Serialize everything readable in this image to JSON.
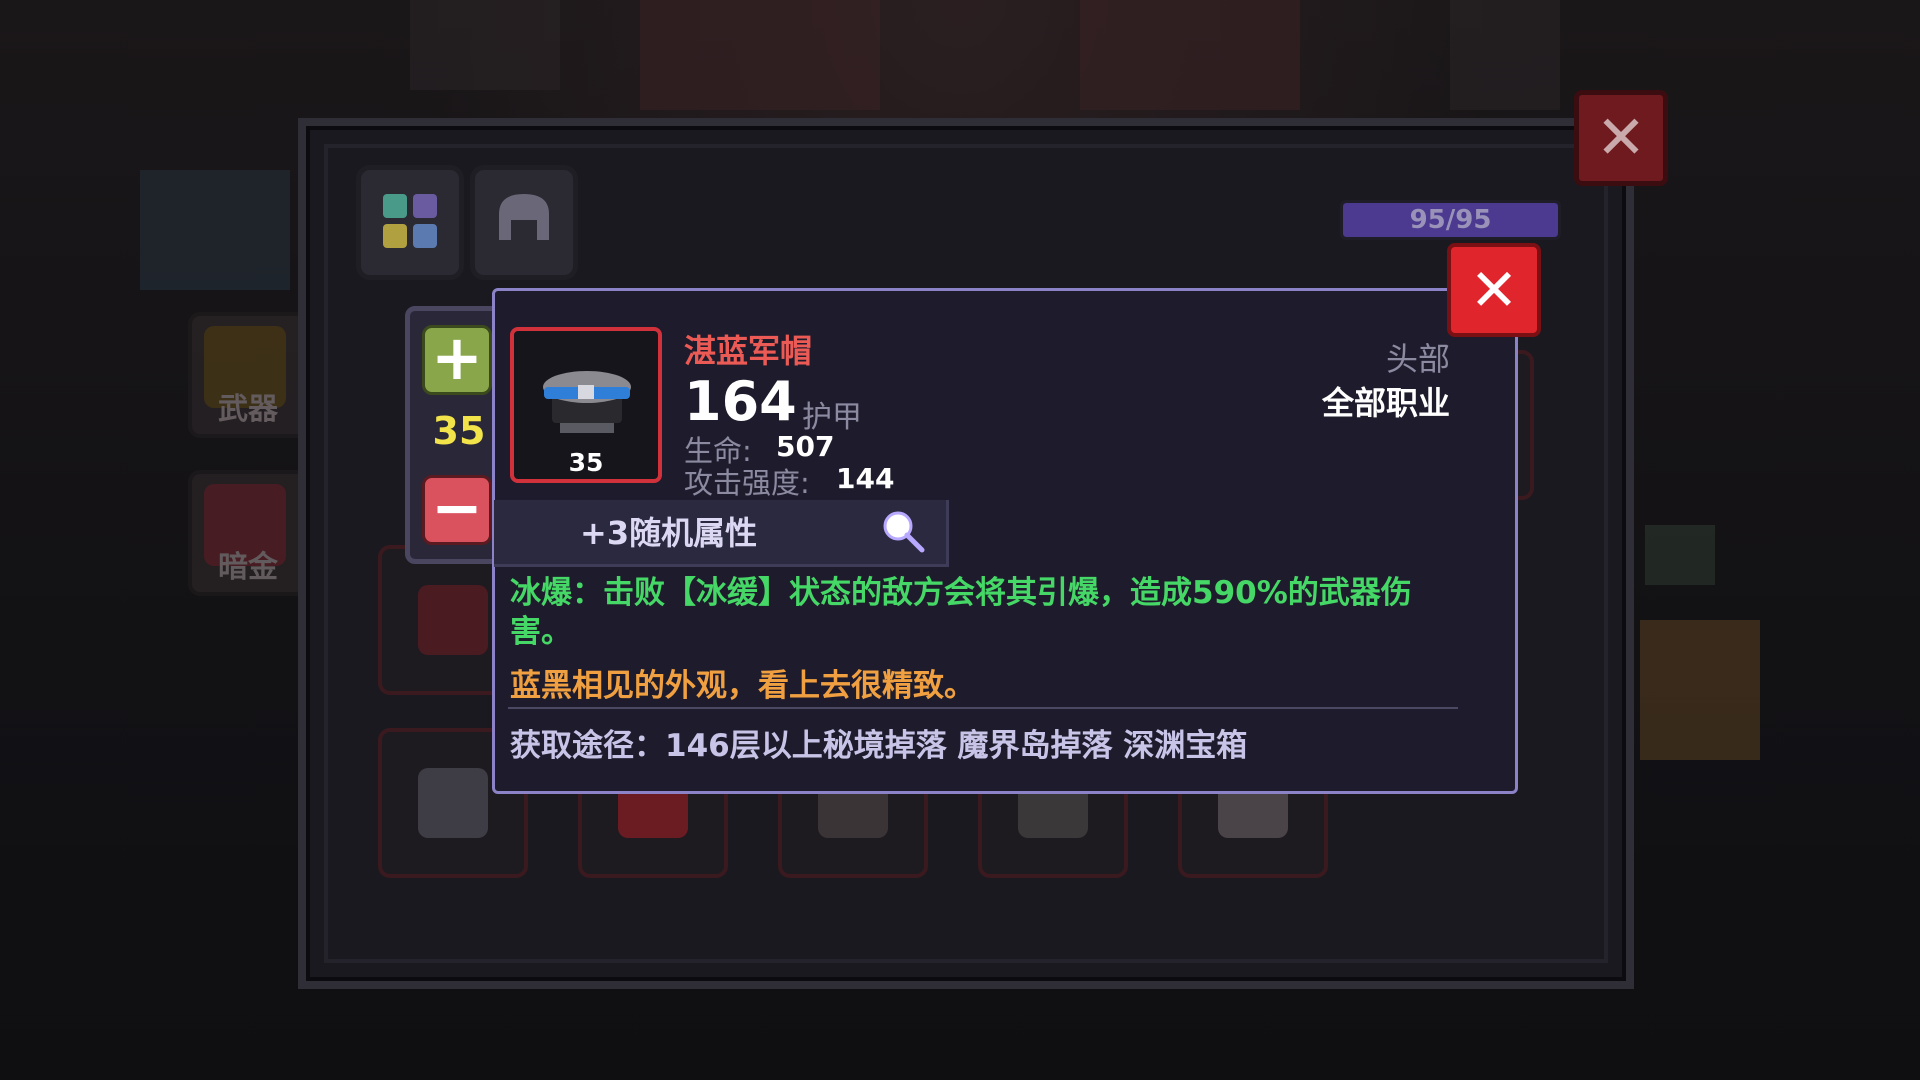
{
  "side_menu": [
    {
      "label": "武器"
    },
    {
      "label": "暗金"
    }
  ],
  "inventory": {
    "capacity_text": "95/95",
    "capacity_fraction": 1.0
  },
  "stepper": {
    "value": "35",
    "plus_icon": "plus-icon",
    "minus_icon": "minus-icon"
  },
  "item": {
    "name": "湛蓝军帽",
    "level": "35",
    "armor_value": "164",
    "armor_label": "护甲",
    "stats": [
      {
        "label": "生命:",
        "value": "507"
      },
      {
        "label": "攻击强度:",
        "value": "144"
      }
    ],
    "slot": "头部",
    "class_requirement": "全部职业",
    "random_attributes": "+3随机属性",
    "effect": "冰爆：击败【冰缓】状态的敌方会将其引爆，造成590%的武器伤害。",
    "flavor": "蓝黑相见的外观，看上去很精致。",
    "source": "获取途径：146层以上秘境掉落 魔界岛掉落 深渊宝箱",
    "colors": {
      "name": "#ec5a55",
      "frame": "#d0313b",
      "effect": "#46d866",
      "flavor": "#f0a040"
    }
  },
  "icons": {
    "close": "close-icon",
    "magnifier": "magnifier-icon"
  }
}
